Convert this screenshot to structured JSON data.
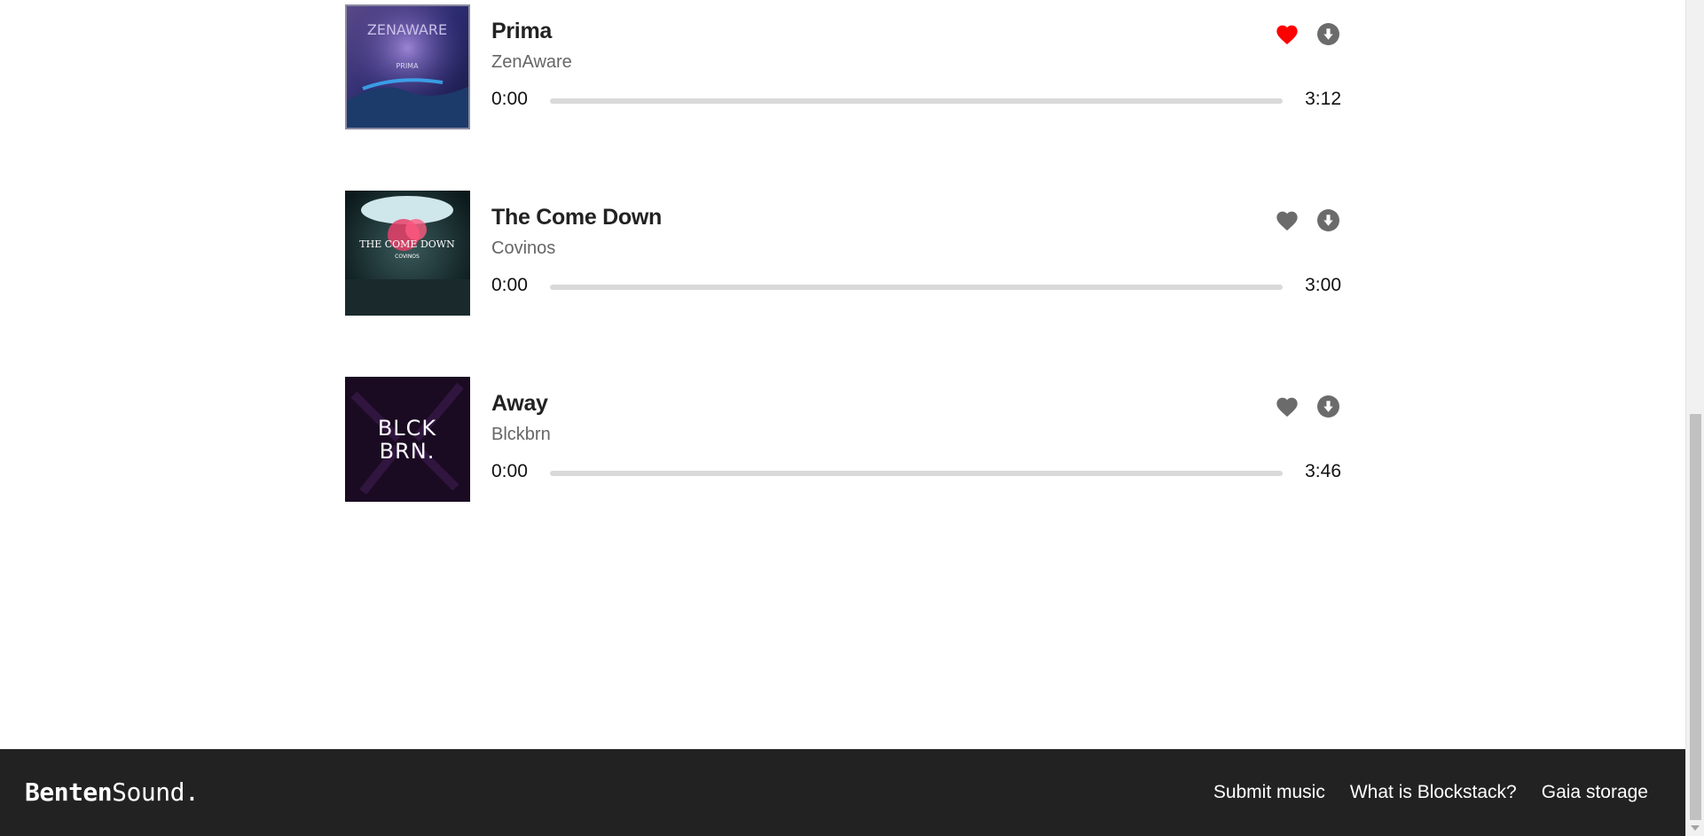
{
  "tracks": [
    {
      "title": "Prima",
      "artist": "ZenAware",
      "time_start": "0:00",
      "time_end": "3:12",
      "progress": 0,
      "liked": true,
      "cover_text": "ZENAWARE",
      "cover_subtext": "PRIMA"
    },
    {
      "title": "The Come Down",
      "artist": "Covinos",
      "time_start": "0:00",
      "time_end": "3:00",
      "progress": 0,
      "liked": false,
      "cover_text": "THE COME DOWN",
      "cover_subtext": "COVINOS"
    },
    {
      "title": "Away",
      "artist": "Blckbrn",
      "time_start": "0:00",
      "time_end": "3:46",
      "progress": 0,
      "liked": false,
      "cover_text": "BLCK",
      "cover_subtext": "BRN."
    }
  ],
  "footer": {
    "brand_bold": "Benten",
    "brand_light": "Sound.",
    "links": [
      "Submit music",
      "What is Blockstack?",
      "Gaia storage"
    ]
  },
  "colors": {
    "liked": "#ff0000",
    "icon": "#6b6b6b",
    "footer_bg": "#222222"
  },
  "icons": {
    "like": "heart-icon",
    "download": "download-icon"
  }
}
